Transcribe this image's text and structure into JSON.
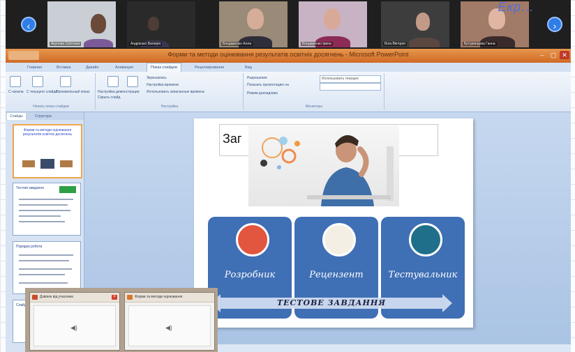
{
  "video_strip": {
    "prev_button": "‹",
    "next_button": "›",
    "participants": [
      {
        "name": "Акулова Світлана"
      },
      {
        "name": "Андрієнко Валерія"
      },
      {
        "name": "Бондаренко Алла"
      },
      {
        "name": "Бондаренко Ірина"
      },
      {
        "name": "Біла Вікторія"
      },
      {
        "name": "Бутуринцева Ганна"
      }
    ],
    "overlay_text": "Екр…"
  },
  "window": {
    "title": "Форми та методи оцінювання результатів освітніх досягнень - Microsoft PowerPoint",
    "controls": {
      "minimize": "–",
      "restore": "▢",
      "close": "✕"
    }
  },
  "ribbon": {
    "tabs": [
      "Главная",
      "Вставка",
      "Дизайн",
      "Анимация",
      "Показ слайдов",
      "Рецензирование",
      "Вид"
    ],
    "active_tab": "Показ слайдов",
    "groups": {
      "start": {
        "label": "Начать показ слайдов",
        "buttons": [
          "С начала",
          "С текущего слайда",
          "Произвольный показ"
        ]
      },
      "setup": {
        "label": "Настройка",
        "buttons": [
          "Настройка демонстрации",
          "Скрыть слайд"
        ],
        "options": [
          "Звукозапись",
          "Настройка времени",
          "Использовать записанные времена"
        ]
      },
      "monitors": {
        "label": "Мониторы",
        "options": [
          "Разрешение",
          "Показать презентацию на",
          "Режим докладчика"
        ],
        "resolution_value": "Использовать текущее"
      }
    }
  },
  "thumb_pane": {
    "tabs": [
      "Слайды",
      "Структура"
    ],
    "active_tab": "Слайды",
    "slides": [
      {
        "title": "Форми та методи оцінювання результатів освітніх досягнень"
      },
      {
        "title": "Тестові завдання"
      },
      {
        "title": "Порядок роботи"
      },
      {
        "title": "Слайд"
      }
    ]
  },
  "slide": {
    "title_placeholder": "Заг",
    "cards": [
      {
        "label": "Розробник",
        "icon": "developer-icon"
      },
      {
        "label": "Рецензент",
        "icon": "reviewer-icon"
      },
      {
        "label": "Тестувальник",
        "icon": "tester-icon"
      }
    ],
    "banner": "ТЕСТОВЕ  ЗАВДАННЯ"
  },
  "popups": [
    {
      "title": "Дзвінок від учасника"
    },
    {
      "title": "Форми та методи оцінювання"
    }
  ],
  "colors": {
    "titlebar": "#d9762f",
    "card": "#3f6fb5",
    "video_bg": "#1f1f1f"
  }
}
